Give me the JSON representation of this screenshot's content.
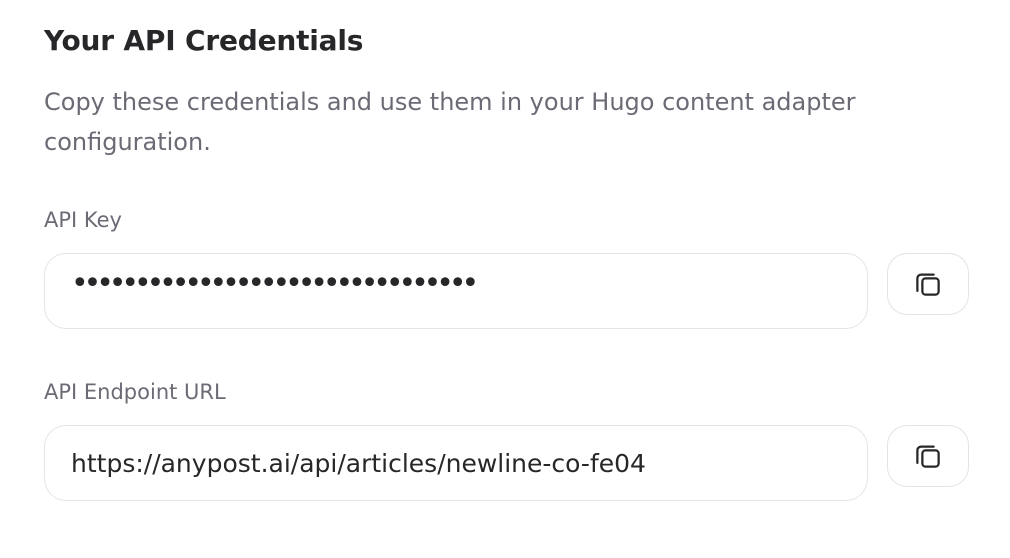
{
  "section": {
    "title": "Your API Credentials",
    "description": "Copy these credentials and use them in your Hugo content adapter configuration."
  },
  "api_key": {
    "label": "API Key",
    "value": "••••••••••••••••••••••••••••••••",
    "copy_icon": "copy-icon"
  },
  "api_endpoint": {
    "label": "API Endpoint URL",
    "value": "https://anypost.ai/api/articles/newline-co-fe04",
    "copy_icon": "copy-icon"
  },
  "colors": {
    "text_primary": "#27272a",
    "text_muted": "#6b6b76",
    "border": "#e4e4e7"
  }
}
